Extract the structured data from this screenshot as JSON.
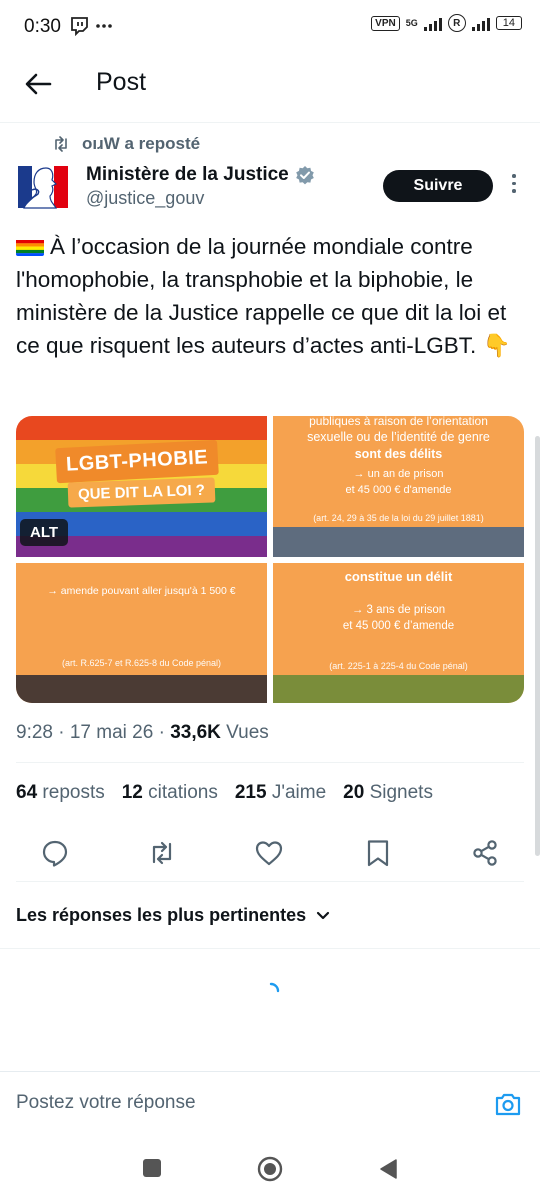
{
  "status_bar": {
    "time": "0:30",
    "left_icons": "📺 ···",
    "vpn": "VPN",
    "network": "5G",
    "carrier_icon": "R",
    "battery": "14"
  },
  "header": {
    "title": "Post"
  },
  "post": {
    "reposted_by": "oıɹW a reposté",
    "author_name": "Ministère de la Justice",
    "author_handle": "@justice_gouv",
    "follow_label": "Suivre",
    "text": "À l’occasion de la journée mondiale contre l'homophobie, la transphobie et la biphobie, le ministère de la Justice rappelle ce que dit la loi et ce que risquent les auteurs d’actes anti-LGBT. 👇",
    "media": {
      "alt_label": "ALT",
      "img1_title": "LGBT-PHOBIE",
      "img1_subtitle": "QUE DIT LA LOI ?",
      "img2_line1": "publiques à raison de l’orientation",
      "img2_line2": "sexuelle ou de l’identité de genre",
      "img2_line3": "sont des délits",
      "img2_line4": "→ un an de prison",
      "img2_line5": "et 45 000 € d'amende",
      "img2_ref": "(art. 24, 29 à 35 de la loi du 29 juillet 1881)",
      "img3_line1": "→ amende pouvant aller jusqu'à 1 500 €",
      "img3_ref": "(art. R.625-7 et R.625-8 du Code pénal)",
      "img4_line1": "constitue un délit",
      "img4_line2": "→ 3 ans de prison",
      "img4_line3": "et 45 000 € d’amende",
      "img4_ref": "(art. 225-1 à 225-4 du Code pénal)"
    },
    "time": "9:28 · 17 mai 26 · ",
    "views_count": "33,6K",
    "views_label": " Vues",
    "stats": {
      "reposts_count": "64",
      "reposts_label": "reposts",
      "quotes_count": "12",
      "quotes_label": "citations",
      "likes_count": "215",
      "likes_label": "J'aime",
      "bookmarks_count": "20",
      "bookmarks_label": "Signets"
    }
  },
  "replies_sort_label": "Les réponses les plus pertinentes",
  "reply_placeholder": "Postez votre réponse",
  "colors": {
    "accent": "#1d9bf0",
    "follow_bg": "#0f1419",
    "image_orange": "#f6a24f"
  }
}
